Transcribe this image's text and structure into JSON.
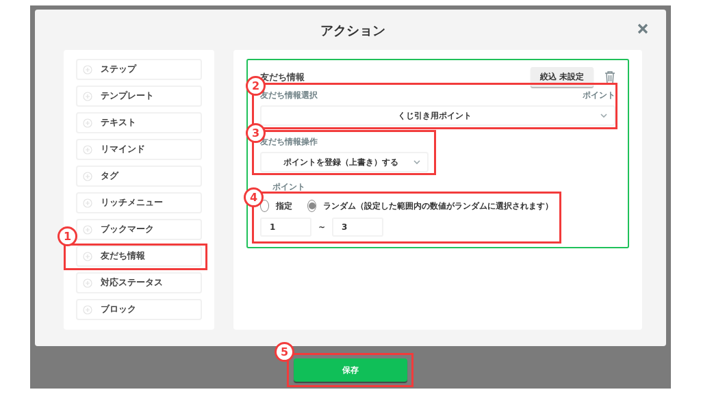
{
  "dialog": {
    "title": "アクション"
  },
  "action_types": [
    {
      "label": "ステップ"
    },
    {
      "label": "テンプレート"
    },
    {
      "label": "テキスト"
    },
    {
      "label": "リマインド"
    },
    {
      "label": "タグ"
    },
    {
      "label": "リッチメニュー"
    },
    {
      "label": "ブックマーク"
    },
    {
      "label": "友だち情報",
      "callout": "1"
    },
    {
      "label": "対応ステータス"
    },
    {
      "label": "ブロック"
    }
  ],
  "card": {
    "title": "友だち情報",
    "filter_button": "絞込 未設定",
    "info_select": {
      "label": "友だち情報選択",
      "type_label": "ポイント",
      "value": "くじ引き用ポイント",
      "callout": "2"
    },
    "operation": {
      "label": "友だち情報操作",
      "value": "ポイントを登録（上書き）する",
      "callout": "3"
    },
    "points": {
      "label": "ポイント",
      "callout": "4",
      "options": [
        {
          "label": "指定",
          "selected": false
        },
        {
          "label": "ランダム（設定した範囲内の数値がランダムに選択されます）",
          "selected": true
        }
      ],
      "min": "1",
      "separator": "~",
      "max": "3"
    }
  },
  "save_button": {
    "label": "保存",
    "callout": "5"
  }
}
